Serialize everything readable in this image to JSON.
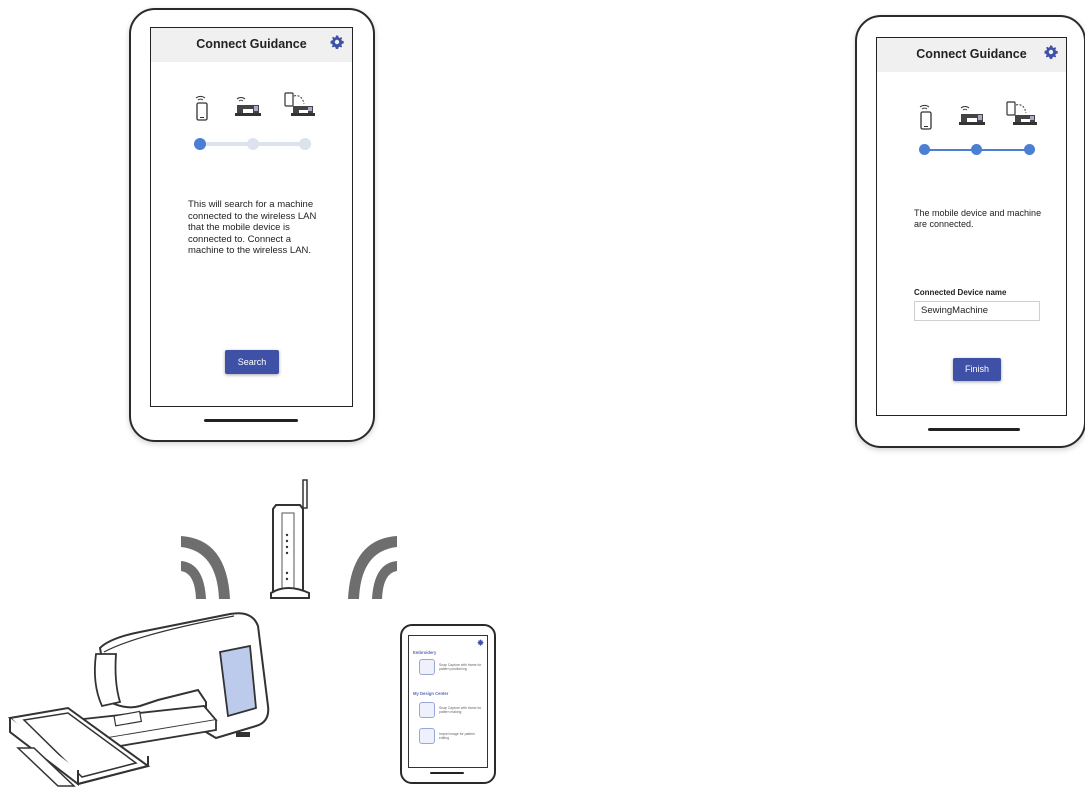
{
  "colors": {
    "accent": "#3f51a6",
    "progress": "#4a7fd4",
    "progress_idle": "#dde3ee",
    "wifi_waves": "#6e6e6e"
  },
  "left_tablet": {
    "title": "Connect Guidance",
    "message": "This will search for a machine connected to the wireless LAN that the mobile device is connected to. Connect a machine to the wireless LAN.",
    "button_label": "Search",
    "progress_step": 1,
    "progress_total": 3
  },
  "right_tablet": {
    "title": "Connect Guidance",
    "message": "The mobile device and machine are connected.",
    "field_label": "Connected Device name",
    "field_value": "SewingMachine",
    "button_label": "Finish",
    "progress_step": 3,
    "progress_total": 3
  },
  "phone": {
    "section1": "Embroidery",
    "item1": "Snap Capture with frame for pattern positioning",
    "section2": "My Design Center",
    "item2": "Snap Capture with frame for pattern making",
    "item3": "Import image for pattern editing"
  }
}
